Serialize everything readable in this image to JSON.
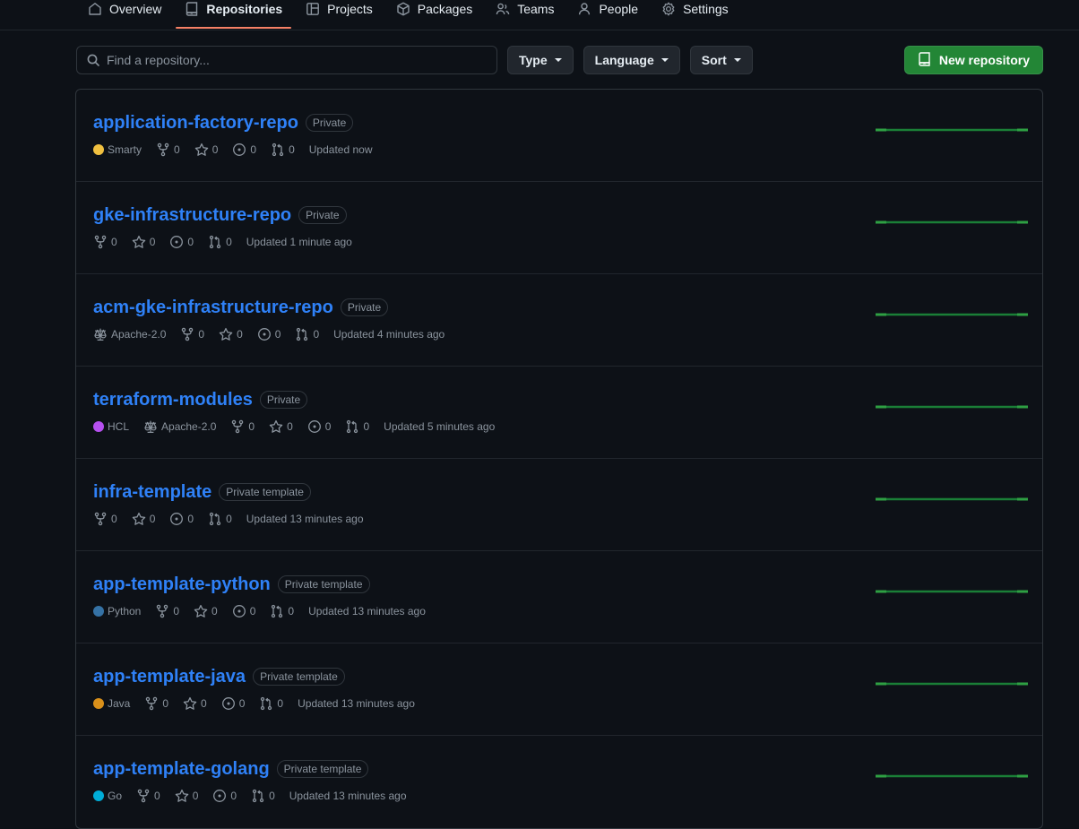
{
  "nav": {
    "tabs": [
      {
        "label": "Overview",
        "icon": "home-icon",
        "active": false
      },
      {
        "label": "Repositories",
        "icon": "repo-icon",
        "active": true
      },
      {
        "label": "Projects",
        "icon": "project-icon",
        "active": false
      },
      {
        "label": "Packages",
        "icon": "package-icon",
        "active": false
      },
      {
        "label": "Teams",
        "icon": "people-icon",
        "active": false
      },
      {
        "label": "People",
        "icon": "person-icon",
        "active": false
      },
      {
        "label": "Settings",
        "icon": "gear-icon",
        "active": false
      }
    ]
  },
  "toolbar": {
    "search_placeholder": "Find a repository...",
    "search_value": "",
    "filters": [
      {
        "label": "Type"
      },
      {
        "label": "Language"
      },
      {
        "label": "Sort"
      }
    ],
    "new_repo_label": "New repository"
  },
  "colors": {
    "accent_blue": "#2f81f7",
    "tab_underline": "#f78166",
    "green_button": "#238636",
    "graph_green": "#1a7f37",
    "background": "#0d1117",
    "border": "#30363d"
  },
  "repositories": [
    {
      "name": "application-factory-repo",
      "visibility": "Private",
      "language": "Smarty",
      "language_color": "#f0c040",
      "license": null,
      "forks": "0",
      "stars": "0",
      "issues": "0",
      "pulls": "0",
      "updated": "Updated now"
    },
    {
      "name": "gke-infrastructure-repo",
      "visibility": "Private",
      "language": null,
      "language_color": null,
      "license": null,
      "forks": "0",
      "stars": "0",
      "issues": "0",
      "pulls": "0",
      "updated": "Updated 1 minute ago"
    },
    {
      "name": "acm-gke-infrastructure-repo",
      "visibility": "Private",
      "language": null,
      "language_color": null,
      "license": "Apache-2.0",
      "forks": "0",
      "stars": "0",
      "issues": "0",
      "pulls": "0",
      "updated": "Updated 4 minutes ago"
    },
    {
      "name": "terraform-modules",
      "visibility": "Private",
      "language": "HCL",
      "language_color": "#b650f0",
      "license": "Apache-2.0",
      "forks": "0",
      "stars": "0",
      "issues": "0",
      "pulls": "0",
      "updated": "Updated 5 minutes ago"
    },
    {
      "name": "infra-template",
      "visibility": "Private template",
      "language": null,
      "language_color": null,
      "license": null,
      "forks": "0",
      "stars": "0",
      "issues": "0",
      "pulls": "0",
      "updated": "Updated 13 minutes ago"
    },
    {
      "name": "app-template-python",
      "visibility": "Private template",
      "language": "Python",
      "language_color": "#3572A5",
      "license": null,
      "forks": "0",
      "stars": "0",
      "issues": "0",
      "pulls": "0",
      "updated": "Updated 13 minutes ago"
    },
    {
      "name": "app-template-java",
      "visibility": "Private template",
      "language": "Java",
      "language_color": "#d9901a",
      "license": null,
      "forks": "0",
      "stars": "0",
      "issues": "0",
      "pulls": "0",
      "updated": "Updated 13 minutes ago"
    },
    {
      "name": "app-template-golang",
      "visibility": "Private template",
      "language": "Go",
      "language_color": "#00ADD8",
      "license": null,
      "forks": "0",
      "stars": "0",
      "issues": "0",
      "pulls": "0",
      "updated": "Updated 13 minutes ago"
    }
  ]
}
